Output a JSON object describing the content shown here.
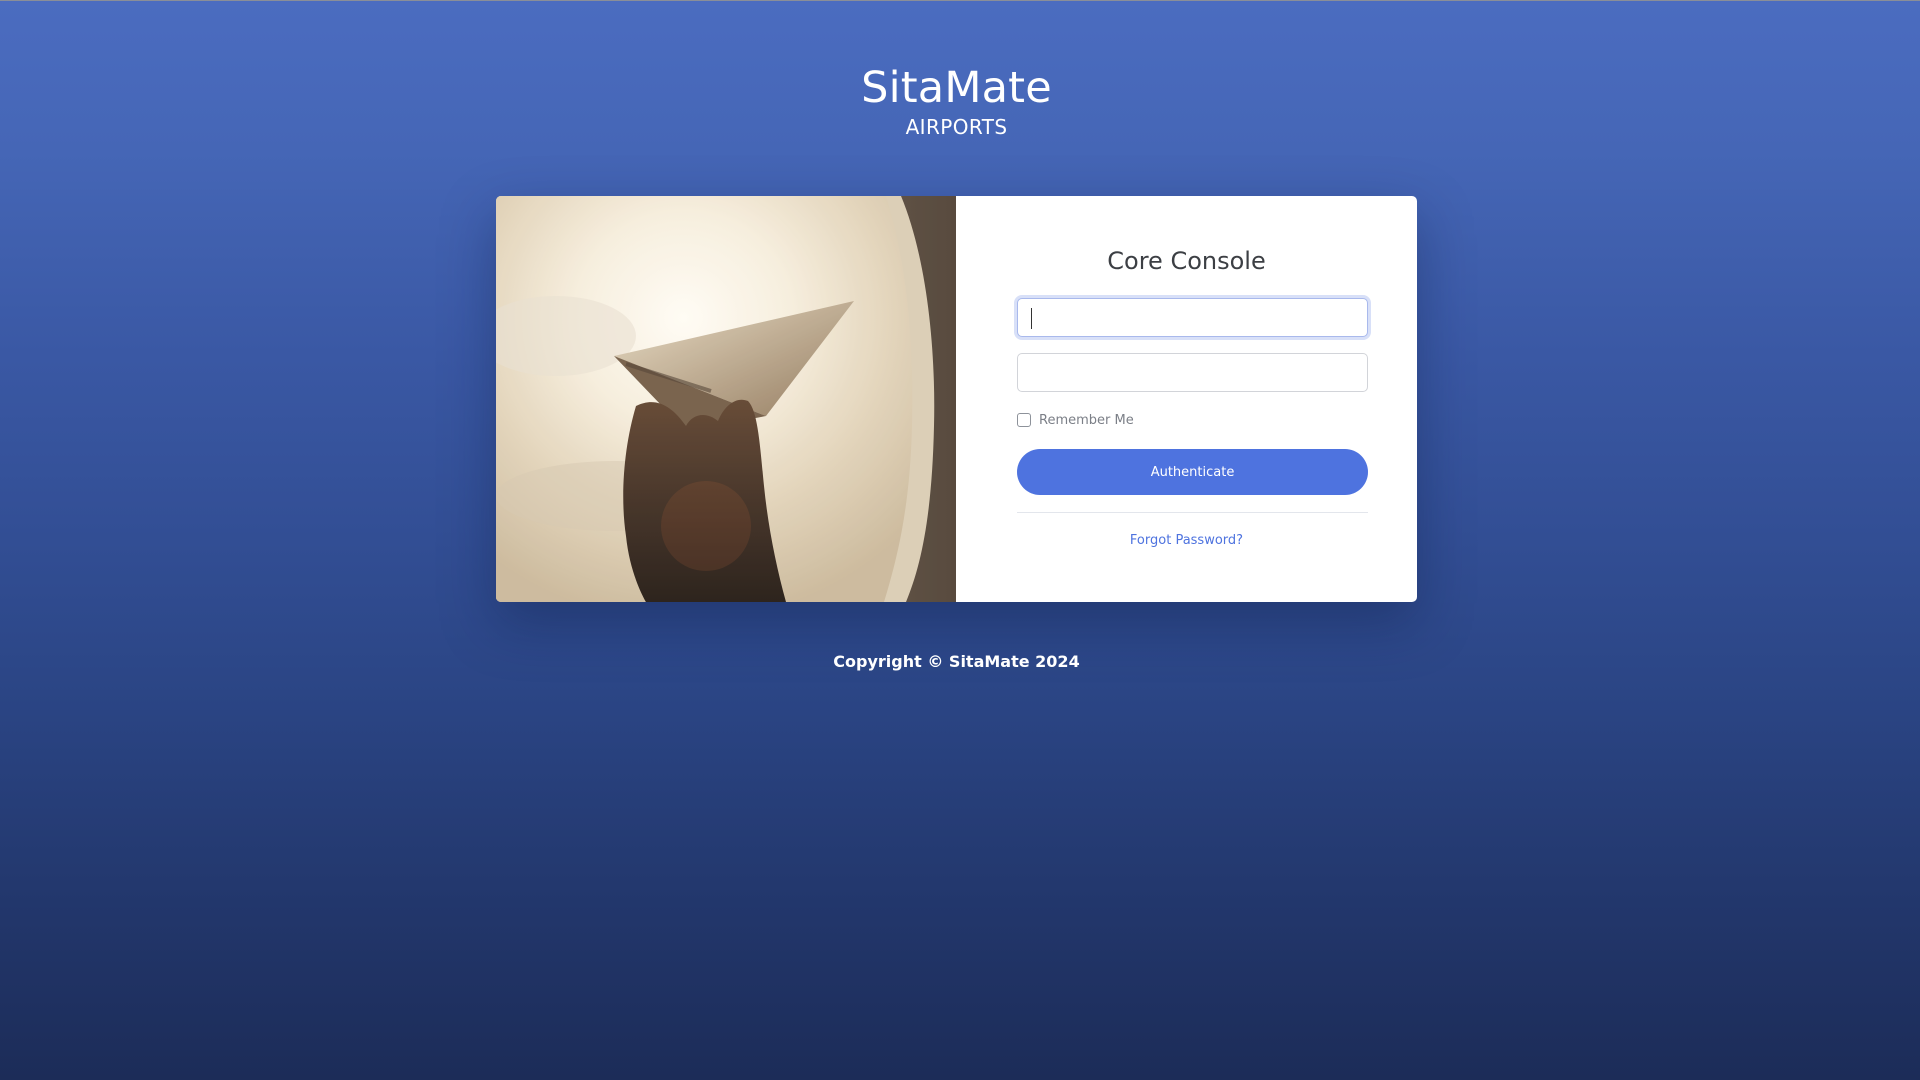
{
  "brand": {
    "title": "SitaMate",
    "subtitle": "AIRPORTS"
  },
  "card": {
    "image_description_icon": "paper-plane-window-photo",
    "form_title": "Core Console",
    "username": {
      "value": "",
      "placeholder": ""
    },
    "password": {
      "value": "",
      "placeholder": ""
    },
    "remember_label": "Remember Me",
    "remember_checked": false,
    "submit_label": "Authenticate",
    "forgot_label": "Forgot Password?"
  },
  "footer": {
    "copyright": "Copyright © SitaMate 2024"
  },
  "colors": {
    "accent": "#4e73df",
    "bg_top": "#4b6cc0",
    "bg_bottom": "#1c2c58"
  }
}
